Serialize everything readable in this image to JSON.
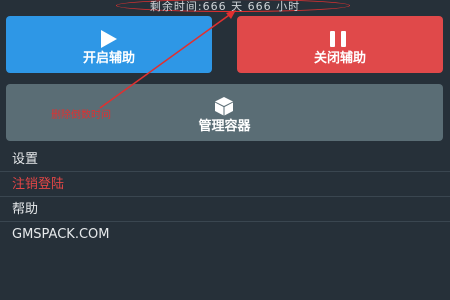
{
  "status": {
    "remaining_time_text": "剩余时间:666 天 666 小时"
  },
  "buttons": {
    "start_label": "开启辅助",
    "stop_label": "关闭辅助",
    "manage_label": "管理容器"
  },
  "annotation": {
    "text": "删除倒数时间"
  },
  "menu": {
    "items": [
      {
        "label": "设置"
      },
      {
        "label": "注销登陆"
      },
      {
        "label": "帮助"
      },
      {
        "label": "GMSPACK.COM"
      }
    ]
  },
  "colors": {
    "background": "#263039",
    "start": "#2e97e6",
    "stop": "#e0494a",
    "manage": "#5a6d75",
    "annotation": "#e03030"
  },
  "icons": {
    "start": "play-icon",
    "stop": "pause-icon",
    "manage": "cube-icon"
  }
}
